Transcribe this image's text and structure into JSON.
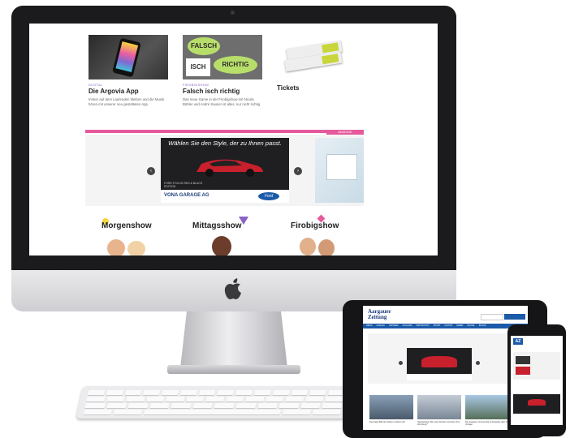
{
  "tiles": [
    {
      "category": "DIGITAL",
      "title": "Die Argovia App",
      "desc": "Immer auf dem Laufenden bleiben und die Musik hören mit unserer neu gestalteten App."
    },
    {
      "category": "FIROBIGSHOW",
      "title": "Falsch isch richtig",
      "desc": "Das neue Game in der Firobigshow mit Nicola Bühler und André Sauser ist alles, nur nicht richtig."
    },
    {
      "category": "",
      "title": "Tickets",
      "desc": ""
    }
  ],
  "falsch": {
    "top": "FALSCH",
    "isch": "ISCH",
    "richtig": "RICHTIG"
  },
  "banner": {
    "tag": "ANZEIGE",
    "headline": "Wählen Sie den Style, der zu Ihnen passt.",
    "model": "FORD FOCUS RED & BLACK EDITION",
    "dealer": "VONA GARAGE AG",
    "brand": "Ford",
    "prev": "‹",
    "next": "›"
  },
  "shows": [
    "Morgenshow",
    "Mittagsshow",
    "Firobigshow"
  ],
  "tablet": {
    "logo_line1": "Aargauer",
    "logo_line2": "Zeitung",
    "menu": [
      "NEWS",
      "AARGAU",
      "SCHWEIZ",
      "AUSLAND",
      "WIRTSCHAFT",
      "SPORT",
      "KULTUR",
      "LEBEN",
      "DIGITAL",
      "BLOGS"
    ],
    "headlines": [
      "Das Fake-Bild der Sieben entlarvt sich",
      "Nachgefragt: Wie viele Schüler wechseln ihre Wohnung?",
      "Der Aargauer Grosse Rat entscheidet über die Vorlage"
    ]
  },
  "phone": {
    "logo": "AZ"
  },
  "colors": {
    "accent": "#e65a9c",
    "purple": "#8a62c5",
    "blue": "#1a5aa8"
  }
}
